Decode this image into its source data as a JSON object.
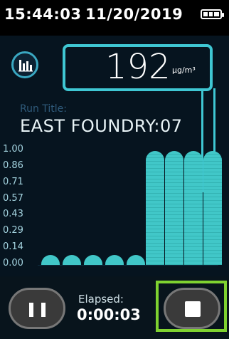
{
  "status_bar": {
    "time": "15:44:03",
    "date": "11/20/2019",
    "icons": {
      "battery": "battery-full-icon"
    }
  },
  "reading": {
    "value": "192",
    "unit": "µg/m³",
    "icon": "bar-chart-icon"
  },
  "run": {
    "title_label": "Run Title:",
    "title": "EAST FOUNDRY:07"
  },
  "chart_data": {
    "type": "bar",
    "y_ticks": [
      "1.00",
      "0.86",
      "0.71",
      "0.57",
      "0.43",
      "0.29",
      "0.14",
      "0.00"
    ],
    "ylim": [
      0,
      1
    ],
    "values": [
      0.03,
      0.03,
      0.03,
      0.03,
      0.03,
      1.0,
      1.0,
      1.0,
      1.0
    ],
    "xlabel": "",
    "ylabel": "",
    "title": "",
    "colors": {
      "bar": "#41c7c8"
    }
  },
  "controls": {
    "pause_icon": "pause-icon",
    "stop_icon": "stop-icon",
    "elapsed_label": "Elapsed:",
    "elapsed_value": "0:00:03"
  },
  "colors": {
    "accent": "#3fc7d3",
    "bar": "#41c7c8",
    "highlight": "#7fd230",
    "background": "#06141f"
  }
}
